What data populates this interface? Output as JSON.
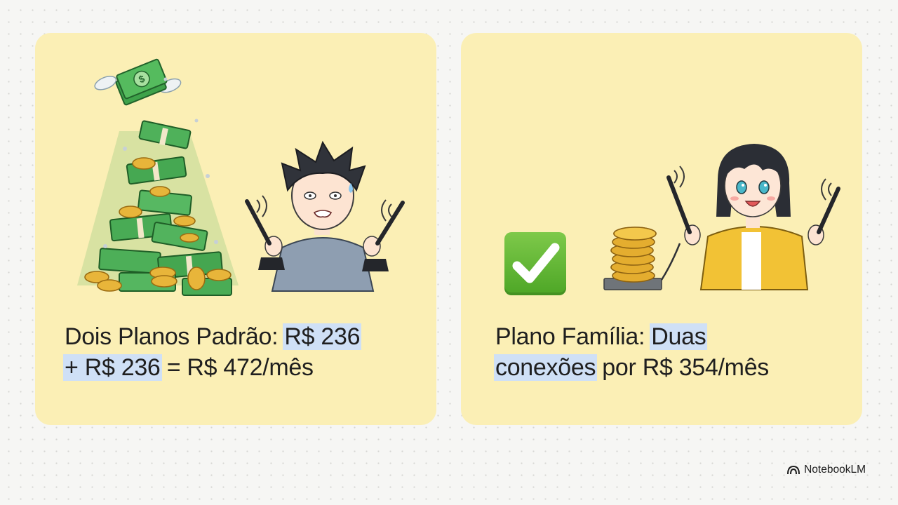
{
  "left_card": {
    "caption_prefix": "Dois Planos Padrão: ",
    "caption_hl1": "R$ 236",
    "caption_hl2": "+ R$ 236",
    "caption_suffix": " = R$ 472/mês",
    "illustration": "money-pile-stressed-boy",
    "icon_money": "dollar-sign-icon"
  },
  "right_card": {
    "caption_prefix": "Plano Família: ",
    "caption_hl1": "Duas",
    "caption_hl2": "conexões",
    "caption_suffix": " por R$ 354/mês",
    "illustration": "coin-stack-happy-girl",
    "icon_check": "check-mark-button-icon"
  },
  "brand": {
    "label": "NotebookLM",
    "icon": "notebooklm-logo-icon"
  },
  "colors": {
    "card_bg": "#fbefb5",
    "highlight": "#cfe0f6",
    "check_green": "#5cb531",
    "text": "#1f1f1f"
  }
}
